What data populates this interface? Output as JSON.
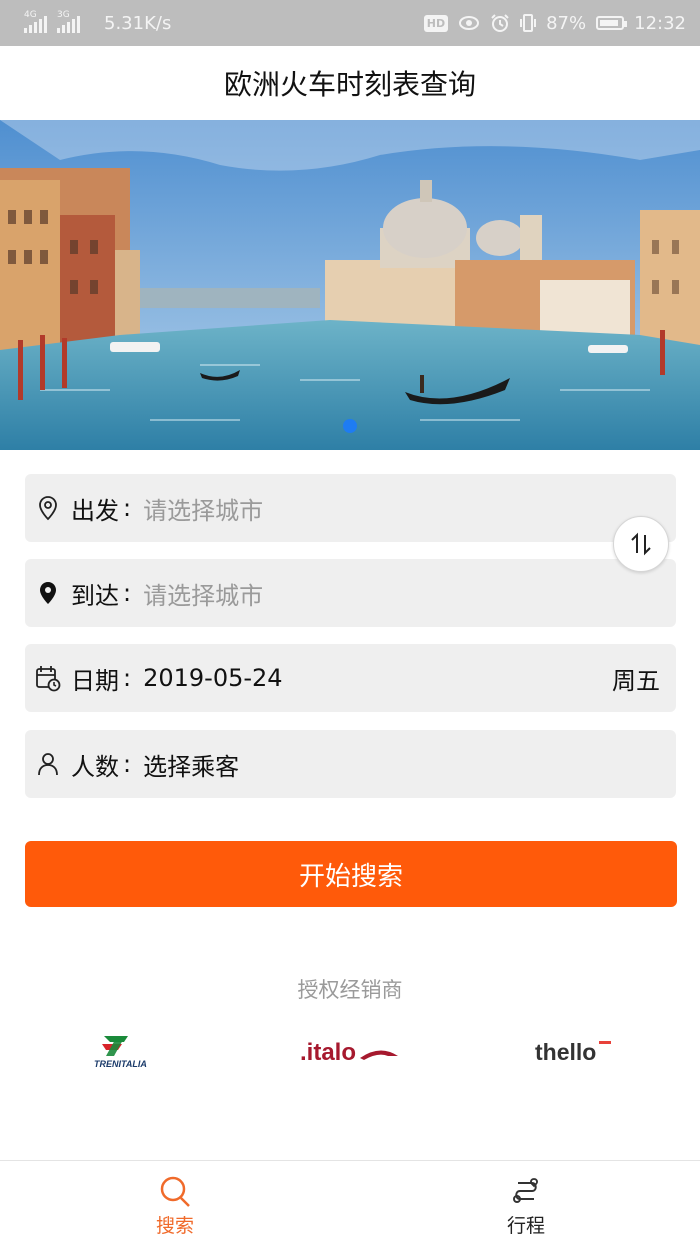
{
  "status_bar": {
    "network1": "4G",
    "network2": "3G",
    "speed": "5.31K/s",
    "hd": "HD",
    "battery": "87%",
    "time": "12:32"
  },
  "header": {
    "title": "欧洲火车时刻表查询"
  },
  "banner": {
    "page_count": 1,
    "active_page": 1
  },
  "form": {
    "departure": {
      "label": "出发",
      "colon": ":",
      "placeholder": "请选择城市",
      "icon": "location-outline-icon"
    },
    "arrival": {
      "label": "到达",
      "colon": ":",
      "placeholder": "请选择城市",
      "icon": "location-filled-icon"
    },
    "date": {
      "label": "日期",
      "colon": ":",
      "value": "2019-05-24",
      "weekday": "周五",
      "icon": "calendar-clock-icon"
    },
    "passengers": {
      "label": "人数",
      "colon": ":",
      "value": "选择乘客",
      "icon": "person-icon"
    },
    "swap_icon": "swap-vertical-icon"
  },
  "search_button": {
    "label": "开始搜索"
  },
  "dealers": {
    "title": "授权经销商",
    "logos": [
      "TRENITALIA",
      ".italo",
      "thello"
    ]
  },
  "tabbar": {
    "tabs": [
      {
        "label": "搜索",
        "icon": "search-icon",
        "active": true
      },
      {
        "label": "行程",
        "icon": "route-icon",
        "active": false
      }
    ]
  },
  "colors": {
    "accent": "#ff5a0a",
    "dot": "#1e7cf2",
    "row_bg": "#efefef",
    "placeholder": "#9a9a9a"
  }
}
